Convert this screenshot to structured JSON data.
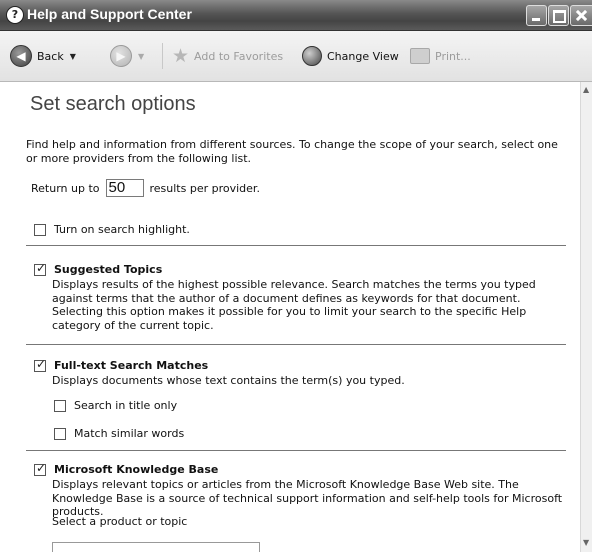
{
  "window": {
    "title": "Help and Support Center"
  },
  "toolbar": {
    "back_label": "Back",
    "add_to_favorites_label": "Add to Favorites",
    "change_view_label": "Change View",
    "print_label": "Print..."
  },
  "page": {
    "title": "Set search options",
    "intro": "Find help and information from different sources. To change the scope of your search, select one or more providers from the following list.",
    "return_prefix": "Return up to",
    "results_value": "50",
    "return_suffix": "results per provider.",
    "highlight_label": "Turn on search highlight."
  },
  "providers": {
    "suggested": {
      "label": "Suggested Topics",
      "checked": true,
      "description": "Displays results of the highest possible relevance. Search matches the terms you typed against terms that the author of a document defines as keywords for that document. Selecting this option makes it possible for you to limit your search to the specific Help category of the current topic."
    },
    "fulltext": {
      "label": "Full-text Search Matches",
      "checked": true,
      "description": "Displays documents whose text contains the term(s) you typed.",
      "title_only_label": "Search in title only",
      "similar_words_label": "Match similar words"
    },
    "kb": {
      "label": "Microsoft Knowledge Base",
      "checked": true,
      "description": "Displays relevant topics or articles from the Microsoft Knowledge Base Web site. The Knowledge Base is a source of technical support information and self-help tools for Microsoft products.",
      "select_label": "Select a product or topic"
    }
  },
  "icons": {
    "help": "help-icon",
    "back": "back-arrow-icon",
    "forward": "forward-arrow-icon",
    "favorites": "star-icon",
    "change_view": "globe-icon",
    "print": "printer-icon"
  }
}
